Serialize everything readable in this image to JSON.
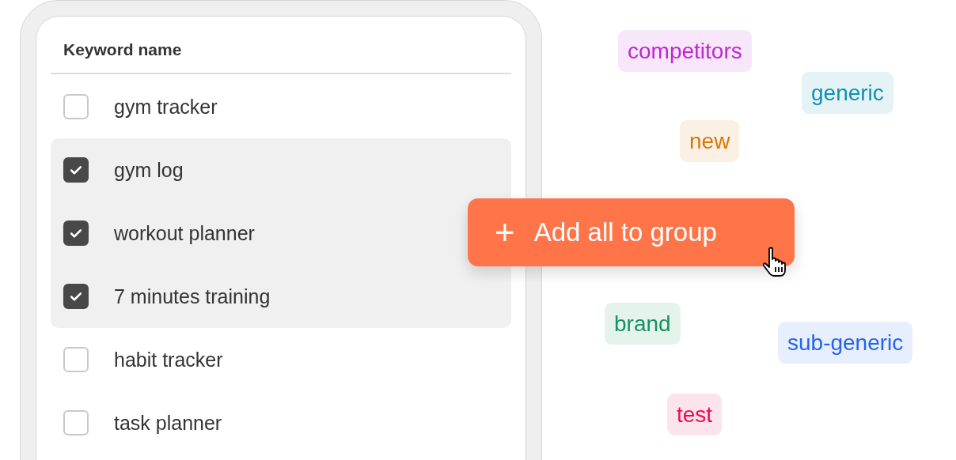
{
  "table": {
    "column_header": "Keyword name",
    "rows": [
      {
        "keyword": "gym tracker",
        "checked": false
      },
      {
        "keyword": "gym log",
        "checked": true
      },
      {
        "keyword": "workout planner",
        "checked": true
      },
      {
        "keyword": "7 minutes training",
        "checked": true
      },
      {
        "keyword": "habit tracker",
        "checked": false
      },
      {
        "keyword": "task planner",
        "checked": false
      }
    ]
  },
  "action_button": {
    "icon": "+",
    "label": "Add all to group"
  },
  "tags": [
    {
      "label": "competitors",
      "color": "#c026d3"
    },
    {
      "label": "generic",
      "color": "#1190b0"
    },
    {
      "label": "new",
      "color": "#d97706"
    },
    {
      "label": "brand",
      "color": "#14945c"
    },
    {
      "label": "sub-generic",
      "color": "#2563eb"
    },
    {
      "label": "test",
      "color": "#f0084f"
    }
  ]
}
